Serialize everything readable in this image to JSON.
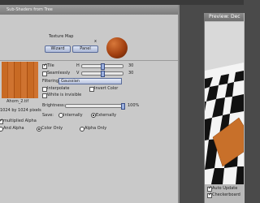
{
  "dialog": {
    "title": "Sub-Shaders from Tree",
    "texture_map_label": "Texture Map",
    "close_glyph": "x",
    "wizard_label": "Wizard",
    "panel_label": "Panel",
    "thumbnail_name": "Ahorn_2.tif",
    "thumbnail_size": "1024 by 1024 pixels",
    "tile": {
      "label": "Tile",
      "checked": true,
      "h_label": "H",
      "h_value": "30",
      "v_label": "V",
      "v_value": "30"
    },
    "seamlessly": {
      "label": "Seamlessly",
      "checked": false
    },
    "filtering": {
      "label": "Filtering:",
      "value": "Gaussian"
    },
    "interpolate": {
      "label": "Interpolate",
      "checked": false
    },
    "invert_color": {
      "label": "Invert Color",
      "checked": false
    },
    "white_invisible": {
      "label": "White is invisible",
      "checked": false
    },
    "brightness": {
      "label": "Brightness:",
      "value": "100%",
      "level": 1.0
    },
    "save": {
      "label": "Save:",
      "internally_label": "Internally",
      "externally_label": "Externally",
      "selected": "Externally"
    },
    "premultiplied_alpha": "multiplied Alpha",
    "and_alpha": "And Alpha",
    "color_only": "Color Only",
    "alpha_only": "Alpha Only",
    "color_mode_selected": "Color Only"
  },
  "preview": {
    "title": "Preview: Dec",
    "auto_update": {
      "label": "Auto Update",
      "checked": true
    },
    "checkerboard": {
      "label": "Checkerboard",
      "checked": true
    }
  },
  "colors": {
    "dialog_bg": "#c9c9c9",
    "titlebar": "#8a8a8a",
    "button_blue": "#aab7d6",
    "wood": "#c86a24"
  }
}
